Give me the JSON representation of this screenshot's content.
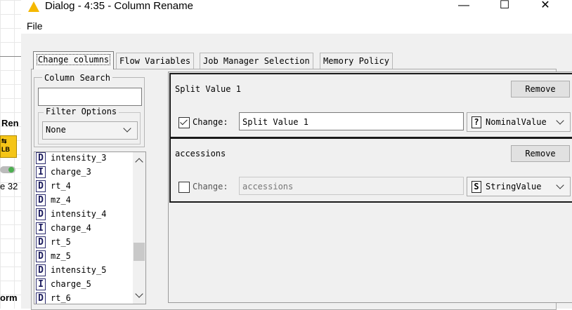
{
  "background": {
    "labels": [
      "Ren",
      "e 32",
      "orm"
    ]
  },
  "window": {
    "title": "Dialog - 4:35 - Column Rename",
    "controls": {
      "minimize": "—",
      "maximize": "☐",
      "close": "✕"
    }
  },
  "menu": {
    "file": "File"
  },
  "tabs": [
    {
      "label": "Change columns",
      "active": true
    },
    {
      "label": "Flow Variables",
      "active": false
    },
    {
      "label": "Job Manager Selection",
      "active": false
    },
    {
      "label": "Memory Policy",
      "active": false
    }
  ],
  "left_panel": {
    "column_search_legend": "Column Search",
    "search_value": "",
    "filter_options_legend": "Filter Options",
    "filter_value": "None",
    "columns": [
      {
        "type": "D",
        "name": "intensity_3"
      },
      {
        "type": "I",
        "name": "charge_3"
      },
      {
        "type": "D",
        "name": "rt_4"
      },
      {
        "type": "D",
        "name": "mz_4"
      },
      {
        "type": "D",
        "name": "intensity_4"
      },
      {
        "type": "I",
        "name": "charge_4"
      },
      {
        "type": "D",
        "name": "rt_5"
      },
      {
        "type": "D",
        "name": "mz_5"
      },
      {
        "type": "D",
        "name": "intensity_5"
      },
      {
        "type": "I",
        "name": "charge_5"
      },
      {
        "type": "D",
        "name": "rt_6"
      }
    ]
  },
  "entries": [
    {
      "column": "Split Value 1",
      "remove_label": "Remove",
      "change_label": "Change:",
      "checked": true,
      "new_name": "Split Value 1",
      "type_badge": "?",
      "type_value": "NominalValue"
    },
    {
      "column": "accessions",
      "remove_label": "Remove",
      "change_label": "Change:",
      "checked": false,
      "new_name": "accessions",
      "type_badge": "S",
      "type_value": "StringValue"
    }
  ]
}
